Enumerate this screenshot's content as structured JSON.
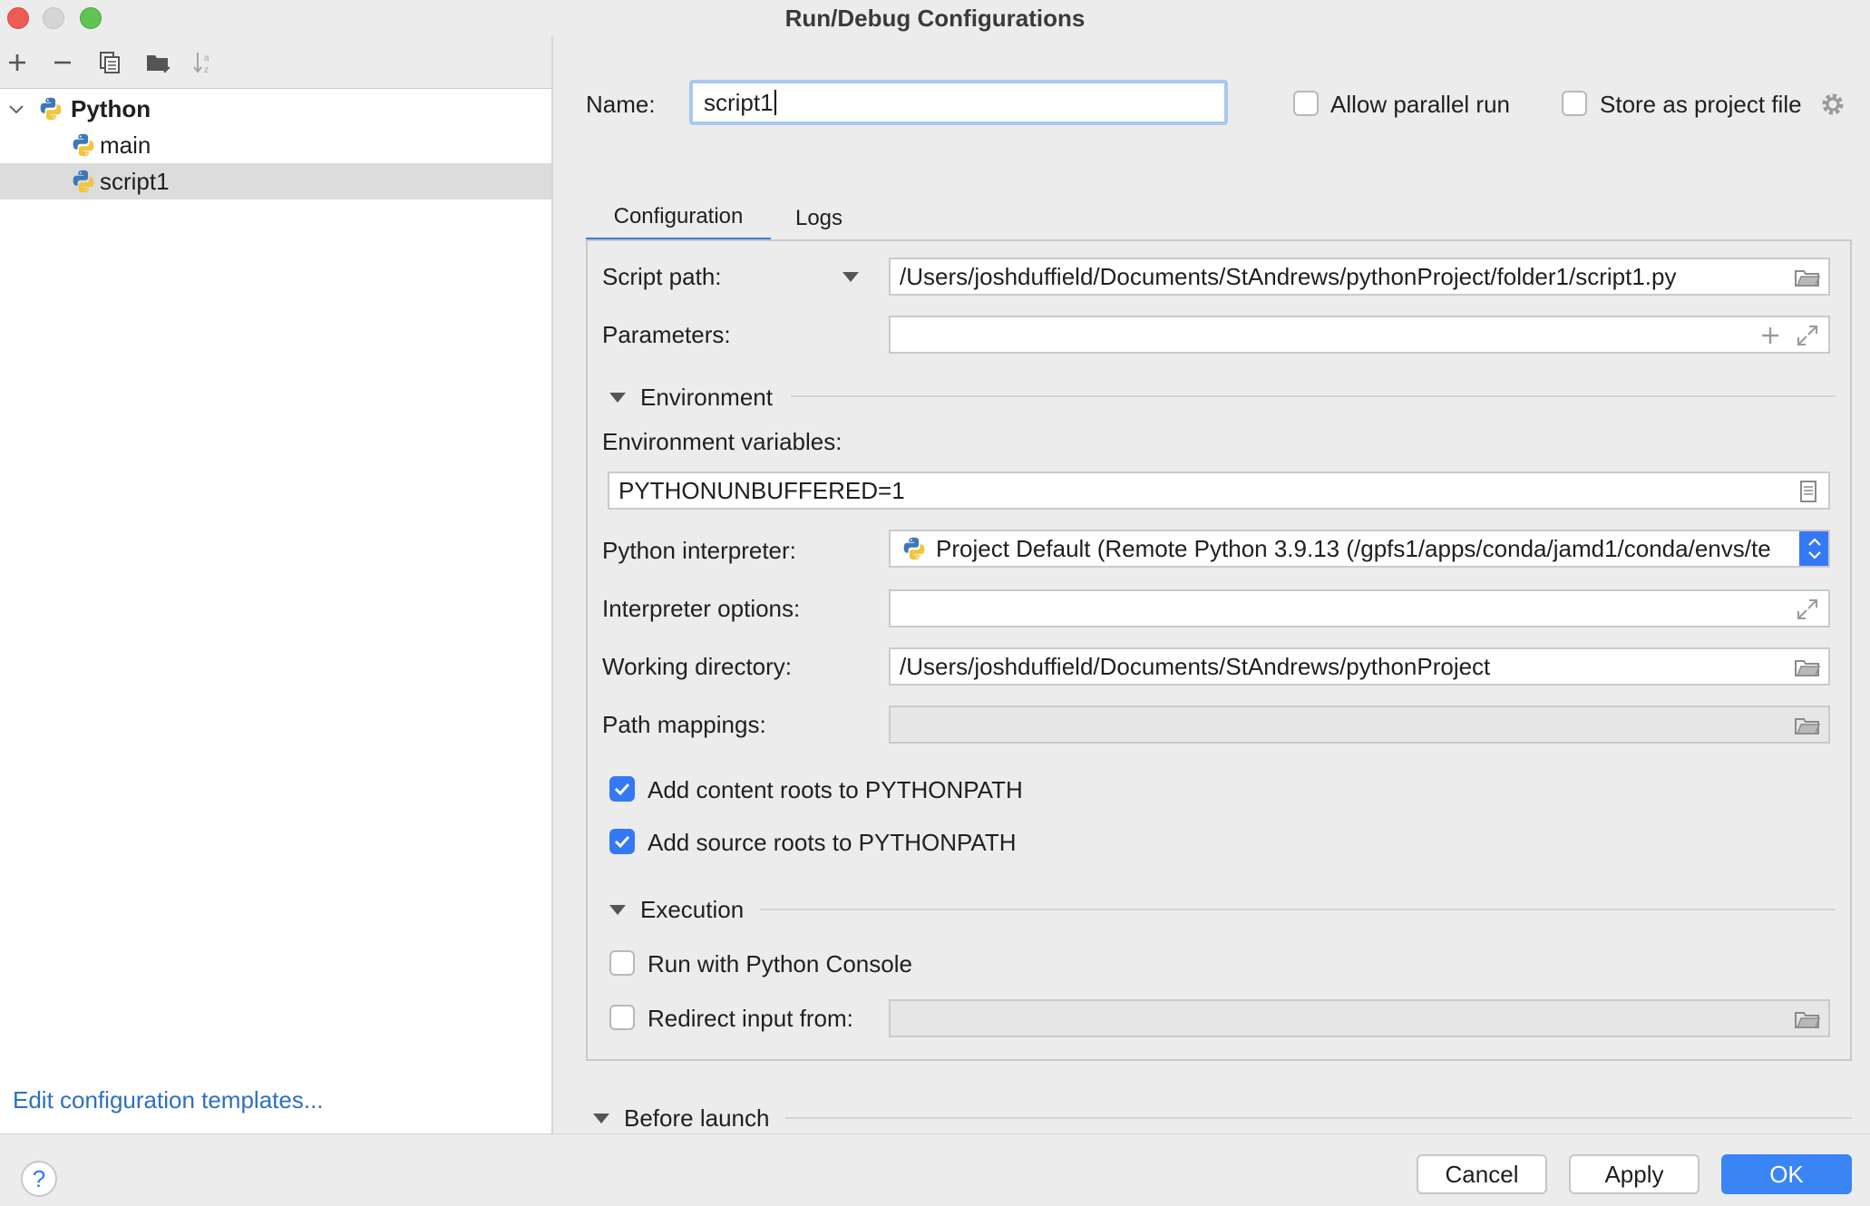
{
  "window": {
    "title": "Run/Debug Configurations"
  },
  "tree": {
    "group_label": "Python",
    "items": [
      {
        "label": "main"
      },
      {
        "label": "script1"
      }
    ],
    "templates_link": "Edit configuration templates..."
  },
  "header": {
    "name_label": "Name:",
    "name_value": "script1",
    "allow_parallel_label": "Allow parallel run",
    "store_project_label": "Store as project file"
  },
  "tabs": [
    {
      "label": "Configuration",
      "active": true
    },
    {
      "label": "Logs",
      "active": false
    }
  ],
  "config": {
    "script_path_label": "Script path:",
    "script_path_value": "/Users/joshduffield/Documents/StAndrews/pythonProject/folder1/script1.py",
    "parameters_label": "Parameters:",
    "parameters_value": "",
    "environment_section": "Environment",
    "env_vars_label": "Environment variables:",
    "env_vars_value": "PYTHONUNBUFFERED=1",
    "interpreter_label": "Python interpreter:",
    "interpreter_value": "Project Default (Remote Python 3.9.13 (/gpfs1/apps/conda/jamd1/conda/envs/te",
    "interpreter_options_label": "Interpreter options:",
    "interpreter_options_value": "",
    "working_dir_label": "Working directory:",
    "working_dir_value": "/Users/joshduffield/Documents/StAndrews/pythonProject",
    "path_mappings_label": "Path mappings:",
    "path_mappings_value": "",
    "content_roots_label": "Add content roots to PYTHONPATH",
    "content_roots_checked": true,
    "source_roots_label": "Add source roots to PYTHONPATH",
    "source_roots_checked": true,
    "execution_section": "Execution",
    "python_console_label": "Run with Python Console",
    "python_console_checked": false,
    "redirect_input_label": "Redirect input from:",
    "redirect_input_checked": false,
    "redirect_input_value": ""
  },
  "before_launch": {
    "label": "Before launch"
  },
  "buttons": {
    "help": "?",
    "cancel": "Cancel",
    "apply": "Apply",
    "ok": "OK"
  },
  "colors": {
    "accent": "#3478f6",
    "link": "#2d6fc4",
    "selection": "#dcdcdc"
  }
}
